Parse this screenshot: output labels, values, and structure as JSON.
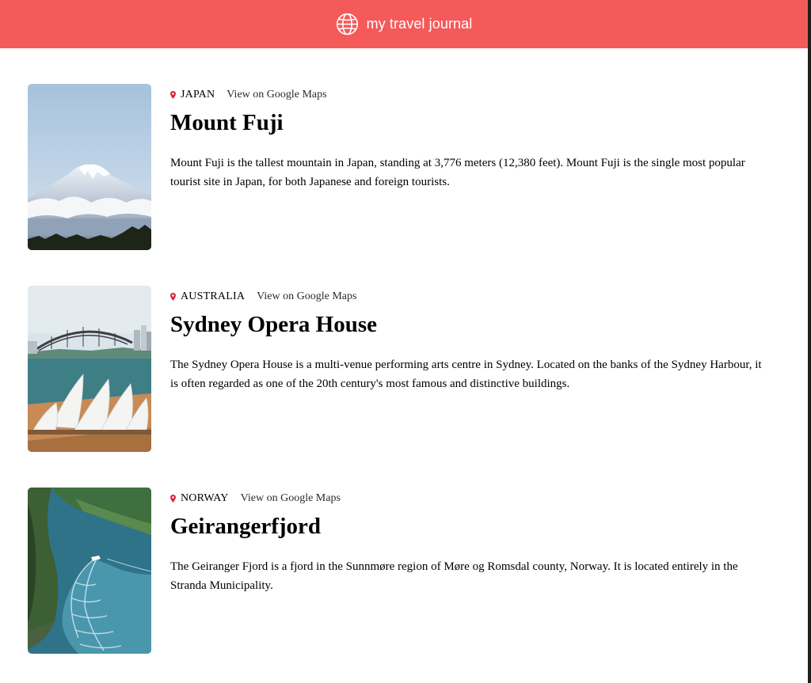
{
  "header": {
    "title": "my travel journal",
    "icon": "globe-icon",
    "background_color": "#f55a5a"
  },
  "entries": [
    {
      "country": "JAPAN",
      "map_link": "View on Google Maps",
      "title": "Mount Fuji",
      "description": "Mount Fuji is the tallest mountain in Japan, standing at 3,776 meters (12,380 feet). Mount Fuji is the single most popular tourist site in Japan, for both Japanese and foreign tourists."
    },
    {
      "country": "AUSTRALIA",
      "map_link": "View on Google Maps",
      "title": "Sydney Opera House",
      "description": "The Sydney Opera House is a multi-venue performing arts centre in Sydney. Located on the banks of the Sydney Harbour, it is often regarded as one of the 20th century's most famous and distinctive buildings."
    },
    {
      "country": "NORWAY",
      "map_link": "View on Google Maps",
      "title": "Geirangerfjord",
      "description": "The Geiranger Fjord is a fjord in the Sunnmøre region of Møre og Romsdal county, Norway. It is located entirely in the Stranda Municipality."
    }
  ],
  "icons": {
    "location": "location-pin-icon",
    "pin_color": "#d9263a"
  }
}
